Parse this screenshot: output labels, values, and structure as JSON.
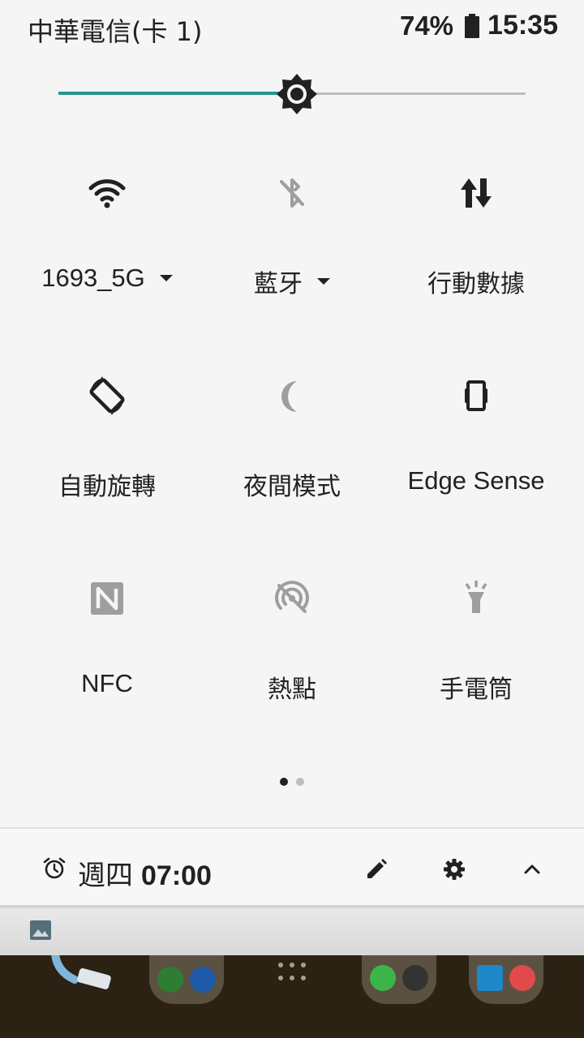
{
  "status_bar": {
    "carrier": "中華電信(卡 1)",
    "battery_percent": "74%",
    "time": "15:35"
  },
  "brightness": {
    "level": 0.51
  },
  "tiles": [
    {
      "label": "1693_5G",
      "icon": "wifi-icon",
      "state": "on",
      "has_dropdown": true
    },
    {
      "label": "藍牙",
      "icon": "bluetooth-off-icon",
      "state": "off",
      "has_dropdown": true
    },
    {
      "label": "行動數據",
      "icon": "mobile-data-icon",
      "state": "on",
      "has_dropdown": false
    },
    {
      "label": "自動旋轉",
      "icon": "auto-rotate-icon",
      "state": "on",
      "has_dropdown": false
    },
    {
      "label": "夜間模式",
      "icon": "night-mode-icon",
      "state": "off",
      "has_dropdown": false
    },
    {
      "label": "Edge Sense",
      "icon": "edge-sense-icon",
      "state": "on",
      "has_dropdown": false
    },
    {
      "label": "NFC",
      "icon": "nfc-icon",
      "state": "off",
      "has_dropdown": false
    },
    {
      "label": "熱點",
      "icon": "hotspot-off-icon",
      "state": "off",
      "has_dropdown": false
    },
    {
      "label": "手電筒",
      "icon": "flashlight-icon",
      "state": "off",
      "has_dropdown": false
    }
  ],
  "pager": {
    "pages": 2,
    "current": 1
  },
  "footer": {
    "alarm_day": "週四",
    "alarm_time": "07:00",
    "icons": [
      "alarm-clock-icon",
      "edit-icon",
      "settings-icon",
      "collapse-icon"
    ]
  },
  "colors": {
    "accent": "#26968a",
    "icon_on": "#212121",
    "icon_off": "#9e9e9e",
    "background": "#f5f5f5"
  }
}
